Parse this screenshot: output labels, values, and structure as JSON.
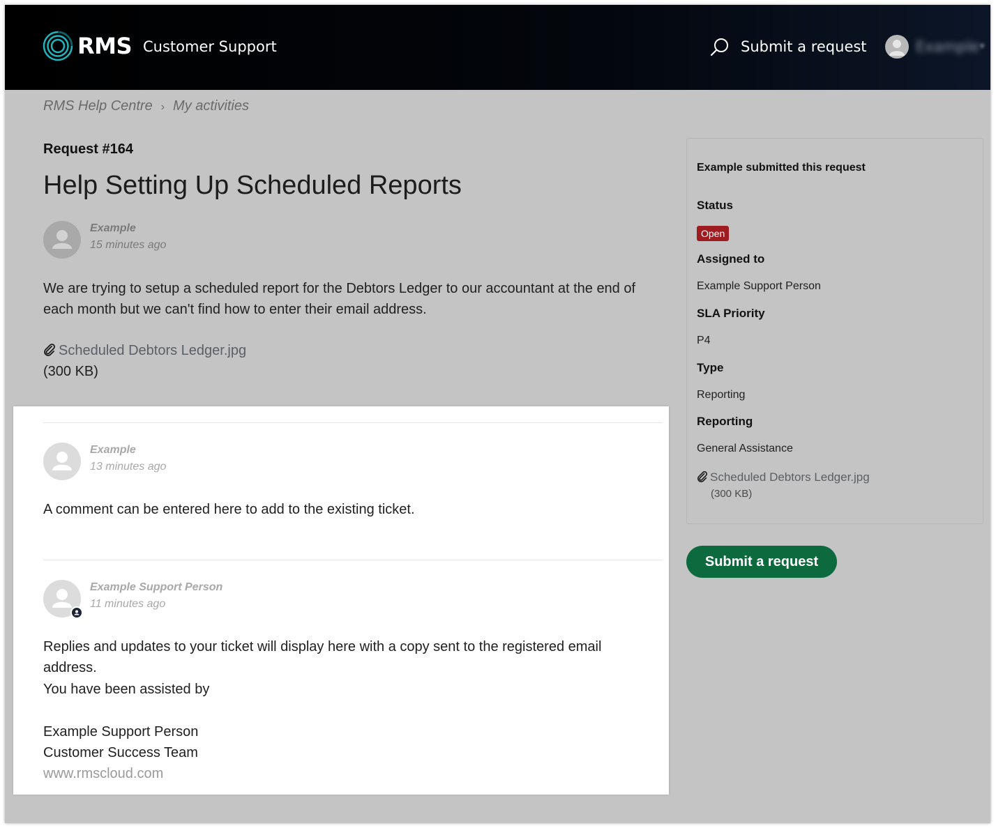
{
  "header": {
    "logo_text": "RMS",
    "portal_name": "Customer Support",
    "submit_label": "Submit a request",
    "user_name": "Example",
    "caret": "▾"
  },
  "breadcrumbs": {
    "items": [
      "RMS Help Centre",
      "My activities"
    ],
    "separator": "›"
  },
  "request": {
    "number_label": "Request #164",
    "title": "Help Setting Up Scheduled Reports",
    "author": "Example",
    "time": "15 minutes ago",
    "description": "We are trying to setup a scheduled report for the Debtors Ledger to our accountant at the end of each month but we can't find how to enter their email address.",
    "attachment_name": "Scheduled Debtors Ledger.jpg",
    "attachment_size": "(300 KB)"
  },
  "comments": [
    {
      "author": "Example",
      "time": "13 minutes ago",
      "text": "A comment can be entered here to add to the existing ticket."
    },
    {
      "author": "Example Support Person",
      "time": "11 minutes ago",
      "line1": "Replies and updates to your ticket will display here with a copy sent to the registered email address.",
      "line2": "You have been assisted by",
      "sig_name": "Example Support Person",
      "sig_team": "Customer Success Team",
      "sig_url": "www.rmscloud.com"
    }
  ],
  "sidebar": {
    "submitted_text": "Example submitted this request",
    "status_label": "Status",
    "status_value": "Open",
    "assigned_label": "Assigned to",
    "assigned_value": "Example Support Person",
    "sla_label": "SLA Priority",
    "sla_value": "P4",
    "type_label": "Type",
    "type_value": "Reporting",
    "reporting_label": "Reporting",
    "reporting_value": "General Assistance",
    "attachment_name": "Scheduled Debtors Ledger.jpg",
    "attachment_size": "(300 KB)"
  },
  "submit_button_label": "Submit a request",
  "colors": {
    "status_open": "#9e1c20",
    "submit_button": "#0c6a3e",
    "logo_accent": "#22b3bd"
  }
}
